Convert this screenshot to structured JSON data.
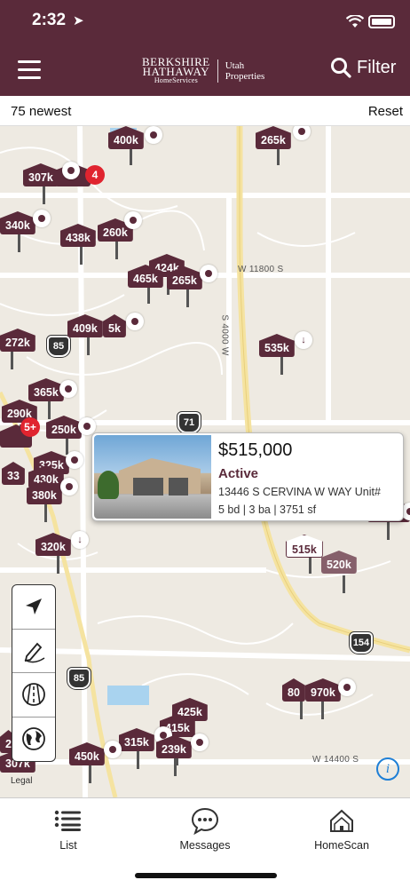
{
  "status_bar": {
    "time": "2:32",
    "location_icon": "location-arrow-icon"
  },
  "header": {
    "brand_line1": "BERKSHIRE",
    "brand_line2": "HATHAWAY",
    "brand_line3": "HomeServices",
    "brand_region_1": "Utah",
    "brand_region_2": "Properties",
    "filter_label": "Filter"
  },
  "subbar": {
    "count_label": "75 newest",
    "reset_label": "Reset"
  },
  "map": {
    "streets": [
      "W 11800 S",
      "S 4000 W",
      "W 14400 S"
    ],
    "highways": [
      "85",
      "71",
      "154",
      "85"
    ],
    "pins": [
      "400k",
      "265k",
      "307k",
      "340k",
      "438k",
      "260k",
      "424k",
      "465k",
      "265k",
      "272k",
      "409k",
      "5k",
      "535k",
      "365k",
      "290k",
      "250k",
      "33",
      "325k",
      "430k",
      "380k",
      "320k",
      "515k",
      "520k",
      "80",
      "970k",
      "425k",
      "415k",
      "315k",
      "239k",
      "450k",
      "2",
      "307k",
      "520k"
    ],
    "badges": [
      "4",
      "5+"
    ],
    "legal": "Legal",
    "info": "i"
  },
  "popup": {
    "price": "$515,000",
    "status": "Active",
    "address": "13446 S CERVINA W WAY Unit#",
    "specs": "5 bd | 3 ba | 3751 sf"
  },
  "tabs": [
    {
      "label": "List",
      "icon": "list-icon"
    },
    {
      "label": "Messages",
      "icon": "messages-icon"
    },
    {
      "label": "HomeScan",
      "icon": "homescan-icon"
    }
  ],
  "colors": {
    "brand": "#5a2a3a",
    "accent_blue": "#1e7fd6",
    "badge_red": "#e0242f"
  }
}
